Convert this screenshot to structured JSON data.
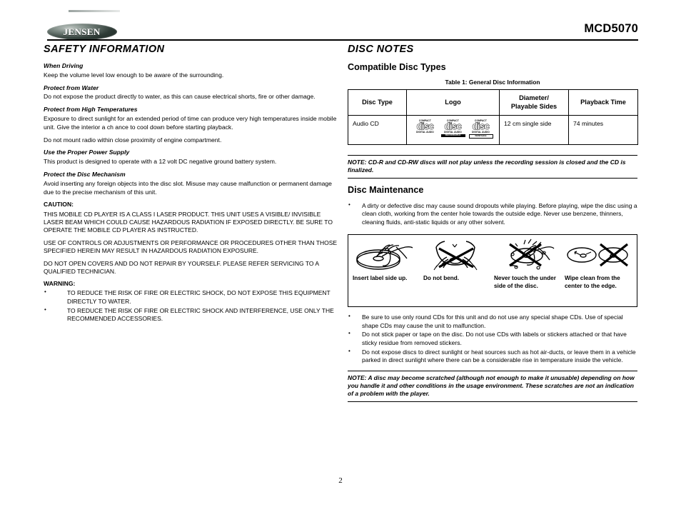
{
  "header": {
    "brand": "JENSEN",
    "model": "MCD5070"
  },
  "safety": {
    "title": "SAFETY INFORMATION",
    "sections": [
      {
        "heading": "When Driving",
        "paragraphs": [
          "Keep the volume level low enough to be aware of the surrounding."
        ]
      },
      {
        "heading": "Protect from Water",
        "paragraphs": [
          "Do not expose the product directly to water, as this can cause electrical shorts, fire or other damage."
        ]
      },
      {
        "heading": "Protect from High Temperatures",
        "paragraphs": [
          "Exposure to direct sunlight for an extended period of time can produce very high temperatures inside mobile unit. Give the interior a ch  ance to cool down before starting playback.",
          "Do not mount radio within close proximity of engine compartment."
        ]
      },
      {
        "heading": "Use the Proper Power Supply",
        "paragraphs": [
          "This product is designed to operate with a 12 volt DC negative ground battery system."
        ]
      },
      {
        "heading": "Protect the Disc Mechanism",
        "paragraphs": [
          "Avoid inserting any foreign objects into the disc slot. Misuse may cause malfunction or permanent damage due to the precise mechanism of this unit."
        ]
      }
    ],
    "caution_label": "CAUTION:",
    "caution_paragraphs": [
      "THIS MOBILE CD PLAYER IS A CLASS I LASER PRODUCT. THIS UNIT USES A VISIBLE/ INVISIBLE LASER BEAM WHICH COULD CAUSE HAZARDOUS RADIATION IF EXPOSED DIRECTLY. BE SURE TO OPERATE THE  MOBILE CD PLAYER AS INSTRUCTED.",
      "USE OF CONTROLS OR ADJUSTMENTS OR PERFORMANCE OR PROCEDURES OTHER THAN THOSE SPECIFIED HEREIN MAY  RESULT IN HAZARDOUS RADIATION EXPOSURE.",
      "DO NOT OPEN COVERS AND DO NOT  REPAIR BY YOURSELF. PLEASE REFER SERVICING TO A QUALIFIED TECHNICIAN."
    ],
    "warning_label": "WARNING:",
    "warning_items": [
      "TO REDUCE THE RISK OF FIRE OR ELECTRIC SHOCK, DO NOT EXPOSE THIS EQUIPMENT DIRECTLY TO WATER.",
      "TO REDUCE THE RISK OF FIRE OR ELECTRIC SHOCK AND INTERFERENCE, USE ONLY THE RECOMMENDED ACCESSORIES."
    ]
  },
  "disc_notes": {
    "title": "DISC NOTES",
    "compatible_heading": "Compatible Disc Types",
    "table_caption": "Table 1: General Disc Information",
    "table": {
      "columns": [
        "Disc Type",
        "Logo",
        "Diameter/ Playable Sides",
        "Playback Time"
      ],
      "column_lines": [
        [
          "Disc Type"
        ],
        [
          "Logo"
        ],
        [
          "Diameter/",
          "Playable Sides"
        ],
        [
          "Playback Time"
        ]
      ],
      "rows": [
        {
          "disc_type": "Audio CD",
          "logos": [
            {
              "top": "COMPACT",
              "word": "disc",
              "bottom": "DIGITAL AUDIO",
              "tag": ""
            },
            {
              "top": "COMPACT",
              "word": "disc",
              "bottom": "DIGITAL AUDIO",
              "tag": "RECORDABLE"
            },
            {
              "top": "COMPACT",
              "word": "disc",
              "bottom": "DIGITAL AUDIO",
              "tag": "ReWritable"
            }
          ],
          "diameter": "12 cm single side",
          "playback_time": "74 minutes"
        }
      ]
    },
    "note_1": "NOTE: CD-R and CD-RW discs will not play unless the recording session is closed and the CD is finalized.",
    "maintenance_heading": "Disc Maintenance",
    "maintenance_items": [
      "A dirty or defective disc may cause sound dropouts while playing. Before playing, wipe the disc using a clean cloth, working from the center hole towards the outside edge. Never use benzene, thinners, cleaning fluids, anti-static liquids or any other solvent."
    ],
    "illustrations": [
      {
        "icon": "insert-disc-label-up-icon",
        "caption": "Insert label side up."
      },
      {
        "icon": "do-not-bend-disc-icon",
        "caption": "Do not bend."
      },
      {
        "icon": "do-not-touch-underside-icon",
        "caption": "Never touch the under side of the disc."
      },
      {
        "icon": "wipe-disc-center-to-edge-icon",
        "caption": "Wipe clean from the center to the edge."
      }
    ],
    "care_items": [
      "Be sure to use only round CDs for this unit and do not use any special shape CDs. Use of special shape CDs may cause the unit to malfunction.",
      "Do not stick paper or tape on the disc. Do not use CDs with labels or stickers attached or that have sticky residue from removed stickers.",
      "Do not expose discs to direct sunlight or heat sources such as hot air-ducts, or leave them in a vehicle parked in direct sunlight where there can be a considerable rise in temperature inside the vehicle."
    ],
    "note_2": "NOTE: A disc may become scratched (although not enough to make it unusable) depending on how you handle it and other conditions in the usage environment. These scratches are not an indication of a problem with the player."
  },
  "footer": {
    "page_number": "2"
  }
}
